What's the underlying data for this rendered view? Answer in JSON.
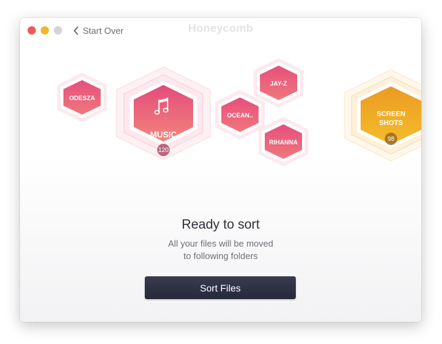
{
  "window": {
    "app_title": "Honeycomb",
    "back_label": "Start Over"
  },
  "colors": {
    "close": "#ee5a55",
    "minimize": "#f2b82b",
    "maximize": "#d4d4d6",
    "pink_hex": "#e8537c",
    "orange_hex": "#eea321",
    "button": "#2f3043"
  },
  "folders": [
    {
      "label": "ODESZA",
      "icon": "none"
    },
    {
      "label": "MUSIC",
      "icon": "music-note-icon",
      "count": "120"
    },
    {
      "label": "OCEAN..",
      "icon": "none"
    },
    {
      "label": "JAY-Z",
      "icon": "none"
    },
    {
      "label": "RIHANNA",
      "icon": "none"
    },
    {
      "label_line1": "SCREEN",
      "label_line2": "SHOTS",
      "icon": "none",
      "count": "98"
    }
  ],
  "status": {
    "title": "Ready to sort",
    "line1": "All your files will be moved",
    "line2": "to following folders"
  },
  "sort_button": {
    "label": "Sort Files"
  }
}
